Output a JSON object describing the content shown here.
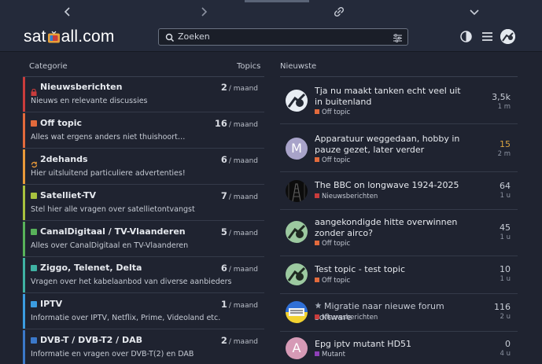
{
  "topnav": {
    "back_icon": "chevron-left-icon",
    "forward_icon": "chevron-right-icon",
    "link_icon": "link-icon",
    "menu_icon": "chevron-down-icon"
  },
  "header": {
    "logo_pre": "sat",
    "logo_post": "all.com",
    "search_placeholder": "Zoeken",
    "icons": [
      "search-icon",
      "filter-icon",
      "theme-toggle-icon",
      "hamburger-icon",
      "user-avatar"
    ]
  },
  "categories_header": {
    "label": "Categorie",
    "topics": "Topics"
  },
  "latest_header": {
    "label": "Nieuwste"
  },
  "categories": [
    {
      "name": "Nieuwsberichten",
      "desc": "Nieuws en relevante discussies",
      "count": "2",
      "per": "/ maand",
      "color": "#c93c3c",
      "icon": "lock-icon"
    },
    {
      "name": "Off topic",
      "desc": "Alles wat ergens anders niet thuishoort…",
      "count": "16",
      "per": "/ maand",
      "color": "#e26a3c",
      "icon": ""
    },
    {
      "name": "2dehands",
      "desc": "Hier uitsluitend particuliere advertenties!",
      "count": "6",
      "per": "/ maand",
      "color": "#e8993a",
      "icon": "refresh-icon"
    },
    {
      "name": "Satelliet-TV",
      "desc": "Stel hier alle vragen over satellietontvangst",
      "count": "7",
      "per": "/ maand",
      "color": "#a8c23f",
      "icon": ""
    },
    {
      "name": "CanalDigitaal / TV-Vlaanderen",
      "desc": "Alles over CanalDigitaal en TV-Vlaanderen",
      "count": "5",
      "per": "/ maand",
      "color": "#58b25a",
      "icon": ""
    },
    {
      "name": "Ziggo, Telenet, Delta",
      "desc": "Vragen over het kabelaanbod van diverse aanbieders",
      "count": "6",
      "per": "/ maand",
      "color": "#3fb2a3",
      "icon": ""
    },
    {
      "name": "IPTV",
      "desc": "Informatie over IPTV, Netflix, Prime, Videoland etc.",
      "count": "1",
      "per": "/ maand",
      "color": "#3b9ce0",
      "icon": ""
    },
    {
      "name": "DVB-T / DVB-T2 / DAB",
      "desc": "Informatie en vragen over DVB-T(2) en DAB",
      "count": "2",
      "per": "/ maand",
      "color": "#3b78c9",
      "icon": ""
    }
  ],
  "topics": [
    {
      "title": "Tja nu maakt tanken echt veel uit in buitenland",
      "category": "Off topic",
      "cat_color": "#e26a3c",
      "replies": "3,5k",
      "age": "1 m",
      "avatar": "bird",
      "avatar_letter": "",
      "highlight": false
    },
    {
      "title": "Apparatuur weggedaan, hobby in pauze gezet, later verder",
      "category": "Off topic",
      "cat_color": "#e26a3c",
      "replies": "15",
      "age": "2 m",
      "avatar": "letter",
      "avatar_letter": "M",
      "highlight": true
    },
    {
      "title": "The BBC on longwave 1924-2025",
      "category": "Nieuwsberichten",
      "cat_color": "#c93c3c",
      "replies": "64",
      "age": "1 u",
      "avatar": "tower",
      "avatar_letter": "",
      "highlight": false
    },
    {
      "title": "aangekondigde hitte overwinnen zonder airco?",
      "category": "Off topic",
      "cat_color": "#e26a3c",
      "replies": "45",
      "age": "1 u",
      "avatar": "bird-green",
      "avatar_letter": "",
      "highlight": false
    },
    {
      "title": "Test topic - test topic",
      "category": "Off topic",
      "cat_color": "#e26a3c",
      "replies": "10",
      "age": "1 u",
      "avatar": "bird-green",
      "avatar_letter": "",
      "highlight": false
    },
    {
      "title": "Migratie naar nieuwe forum software",
      "category": "Nieuwsberichten",
      "cat_color": "#c93c3c",
      "replies": "116",
      "age": "2 u",
      "avatar": "flag",
      "avatar_letter": "",
      "highlight": false,
      "pinned": true
    },
    {
      "title": "Epg iptv mutant HD51",
      "category": "Mutant",
      "cat_color": "#8e3fb8",
      "replies": "0",
      "age": "4 u",
      "avatar": "letter-pink",
      "avatar_letter": "A",
      "highlight": false
    }
  ]
}
